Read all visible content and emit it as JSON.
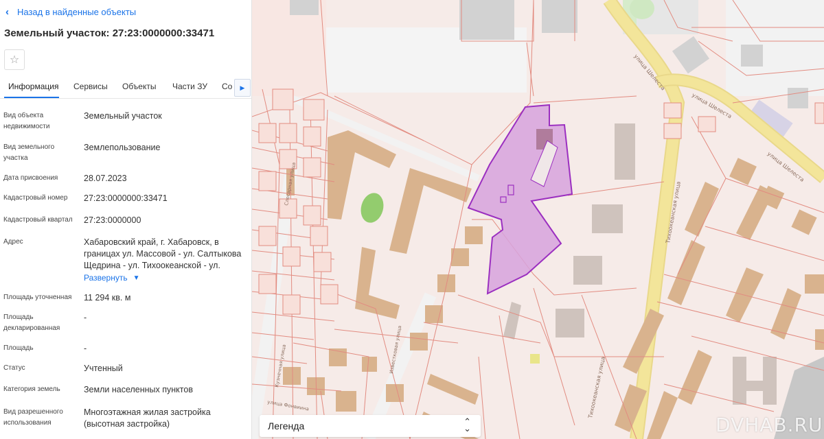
{
  "back_link": "Назад в найденные объекты",
  "title": "Земельный участок: 27:23:0000000:33471",
  "tabs": [
    {
      "label": "Информация"
    },
    {
      "label": "Сервисы"
    },
    {
      "label": "Объекты"
    },
    {
      "label": "Части ЗУ"
    },
    {
      "label": "Сос"
    }
  ],
  "rows": [
    {
      "label": "Вид объекта недвижимости",
      "value": "Земельный участок"
    },
    {
      "label": "Вид земельного участка",
      "value": "Землепользование"
    },
    {
      "label": "Дата присвоения",
      "value": "28.07.2023"
    },
    {
      "label": "Кадастровый номер",
      "value": "27:23:0000000:33471"
    },
    {
      "label": "Кадастровый квартал",
      "value": "27:23:0000000"
    },
    {
      "label": "Адрес",
      "value": "Хабаровский край, г. Хабаровск, в границах ул. Массовой - ул. Салтыкова Щедрина - ул. Тихоокеанской - ул."
    },
    {
      "label": "Площадь уточненная",
      "value": "11 294 кв. м"
    },
    {
      "label": "Площадь декларированная",
      "value": "-"
    },
    {
      "label": "Площадь",
      "value": "-"
    },
    {
      "label": "Статус",
      "value": "Учтенный"
    },
    {
      "label": "Категория земель",
      "value": "Земли населенных пунктов"
    },
    {
      "label": "Вид разрешенного использования",
      "value": "Многоэтажная жилая застройка (высотная застройка)"
    }
  ],
  "expand_label": "Развернуть",
  "legend_label": "Легенда",
  "watermark": "DVHAB.RU",
  "streets": {
    "s1": "улица Шелеста",
    "s2": "улица Шелеста",
    "s3": "улица Шелеста",
    "s4": "Тихоокеанская улица",
    "s5": "Тихоокеанская улица",
    "s6": "Кузнечная улица",
    "s7": "Слесарная улица",
    "s8": "Известковая улица",
    "s9": "улица Фонвиина"
  },
  "colors": {
    "accent": "#1a73e8",
    "parcel_fill": "#d7a3dd",
    "parcel_stroke": "#9b2fc0",
    "building": "#d9b38e",
    "road": "#f3e59a"
  }
}
